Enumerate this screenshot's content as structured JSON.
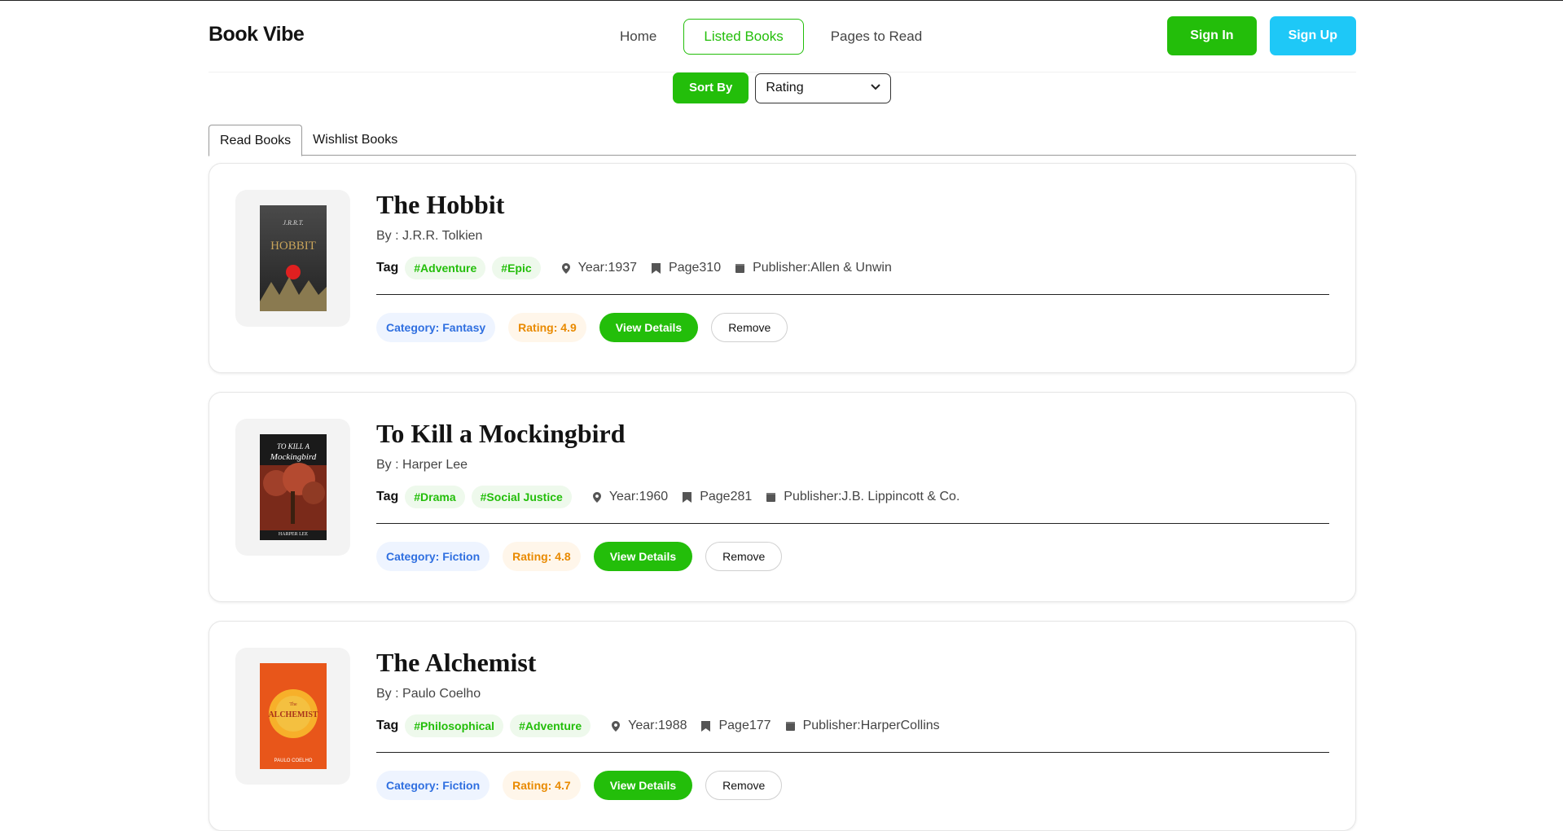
{
  "brand": "Book Vibe",
  "nav": {
    "links": [
      "Home",
      "Listed Books",
      "Pages to Read"
    ],
    "active": "Listed Books"
  },
  "auth": {
    "sign_in": "Sign In",
    "sign_up": "Sign Up"
  },
  "sort": {
    "button": "Sort By",
    "selected": "Rating"
  },
  "tabs": [
    "Read Books",
    "Wishlist Books"
  ],
  "labels": {
    "by_prefix": "By : ",
    "tag": "Tag",
    "year_prefix": "Year: ",
    "page_prefix": "Page ",
    "publisher_prefix": "Publisher: ",
    "category_prefix": "Category: ",
    "rating_prefix": "Rating: ",
    "view_details": "View Details",
    "remove": "Remove"
  },
  "books": [
    {
      "title": "The Hobbit",
      "author": "J.R.R. Tolkien",
      "tags": [
        "#Adventure",
        "#Epic"
      ],
      "year": "1937",
      "pages": "310",
      "publisher": "Allen & Unwin",
      "category": "Fantasy",
      "rating": "4.9"
    },
    {
      "title": "To Kill a Mockingbird",
      "author": "Harper Lee",
      "tags": [
        "#Drama",
        "#Social Justice"
      ],
      "year": "1960",
      "pages": "281",
      "publisher": "J.B. Lippincott & Co.",
      "category": "Fiction",
      "rating": "4.8"
    },
    {
      "title": "The Alchemist",
      "author": "Paulo Coelho",
      "tags": [
        "#Philosophical",
        "#Adventure"
      ],
      "year": "1988",
      "pages": "177",
      "publisher": "HarperCollins",
      "category": "Fiction",
      "rating": "4.7"
    }
  ],
  "colors": {
    "accent": "#23be0a",
    "secondary": "#1ec8f7"
  }
}
